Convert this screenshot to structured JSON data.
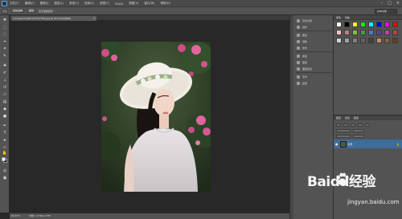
{
  "menubar": {
    "items": [
      "文件(F)",
      "编辑(E)",
      "图像(I)",
      "图层(L)",
      "类型(Y)",
      "选择(S)",
      "滤镜(T)",
      "3D(D)",
      "视图(V)",
      "窗口(W)",
      "帮助(H)"
    ],
    "window_controls": [
      "–",
      "□",
      "×"
    ]
  },
  "optionsbar": {
    "options": [
      "自动选择",
      "图层",
      "显示变换控件"
    ],
    "workspace": "基本功能"
  },
  "document_tab": {
    "title": "mmexport1485137597789.jpg @ 66.7%(RGB/8)",
    "close": "×"
  },
  "statusbar": {
    "zoom": "66.67%",
    "doc": "文档:1.07M/1.07M"
  },
  "left_panel": {
    "items": [
      "历史记录",
      "动作",
      "属性",
      "调整",
      "样式",
      "通道",
      "路径",
      "图层复合",
      "字符",
      "段落"
    ]
  },
  "right_panel": {
    "tabs": [
      "颜色",
      "色板"
    ],
    "swatch_colors": [
      "#ffffff",
      "#000000",
      "#ffff00",
      "#00ff00",
      "#00ffff",
      "#0000ff",
      "#ff00ff",
      "#ff0000",
      "#ffc0c0",
      "#c08080",
      "#7fbf3f",
      "#3f9f3f",
      "#3f7fbf",
      "#5f3f9f",
      "#bf3f9f",
      "#bf3f3f",
      "#d0d0d0",
      "#a0a0a0",
      "#808080",
      "#606060",
      "#404040",
      "#c09060",
      "#806040",
      "#604020"
    ]
  },
  "layers_panel": {
    "tabs": [
      "图层",
      "通道",
      "路径"
    ],
    "layer_name": "背景",
    "eye": "●",
    "lock": "🔒"
  },
  "watermark": {
    "logo": "Baidu经验",
    "url": "jingyan.baidu.com"
  }
}
